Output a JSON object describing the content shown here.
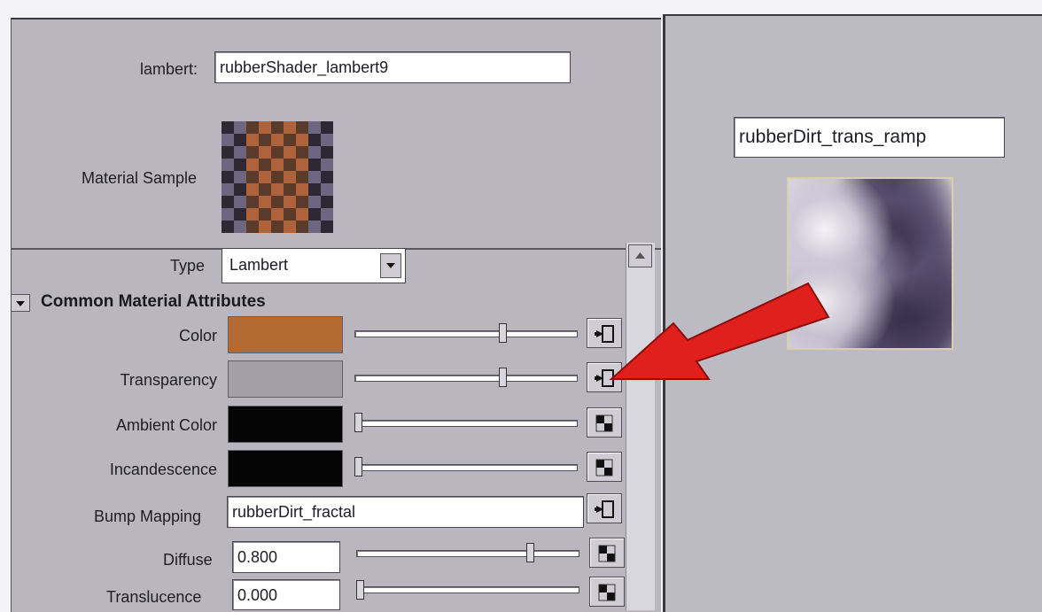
{
  "header": {
    "shader_label": "lambert:",
    "shader_name": "rubberShader_lambert9",
    "sample_label": "Material Sample"
  },
  "attributes": {
    "type_label": "Type",
    "type_value": "Lambert",
    "section_title": "Common Material Attributes",
    "rows": [
      {
        "label": "Color",
        "color": "#b36a33",
        "slider": 0.68
      },
      {
        "label": "Transparency",
        "color": "#a29fa8",
        "slider": 0.68
      },
      {
        "label": "Ambient Color",
        "color": "#050505",
        "slider": 0.0
      },
      {
        "label": "Incandescence",
        "color": "#050505",
        "slider": 0.0
      }
    ],
    "bump_label": "Bump Mapping",
    "bump_value": "rubberDirt_fractal",
    "diffuse_label": "Diffuse",
    "diffuse_value": "0.800",
    "diffuse_slider": 0.8,
    "translucence_label": "Translucence",
    "translucence_value": "0.000",
    "translucence_slider": 0.0
  },
  "texture_panel": {
    "name": "rubberDirt_trans_ramp"
  },
  "colors": {
    "panel_bg": "#b9b6bf",
    "arrow_red": "#e0201c"
  },
  "icons": {
    "input_connection": "map-connected-icon",
    "checker_map": "checker-map-icon",
    "dropdown": "chevron-down-icon",
    "collapse": "triangle-down-icon",
    "scroll_up": "arrow-up-icon"
  }
}
